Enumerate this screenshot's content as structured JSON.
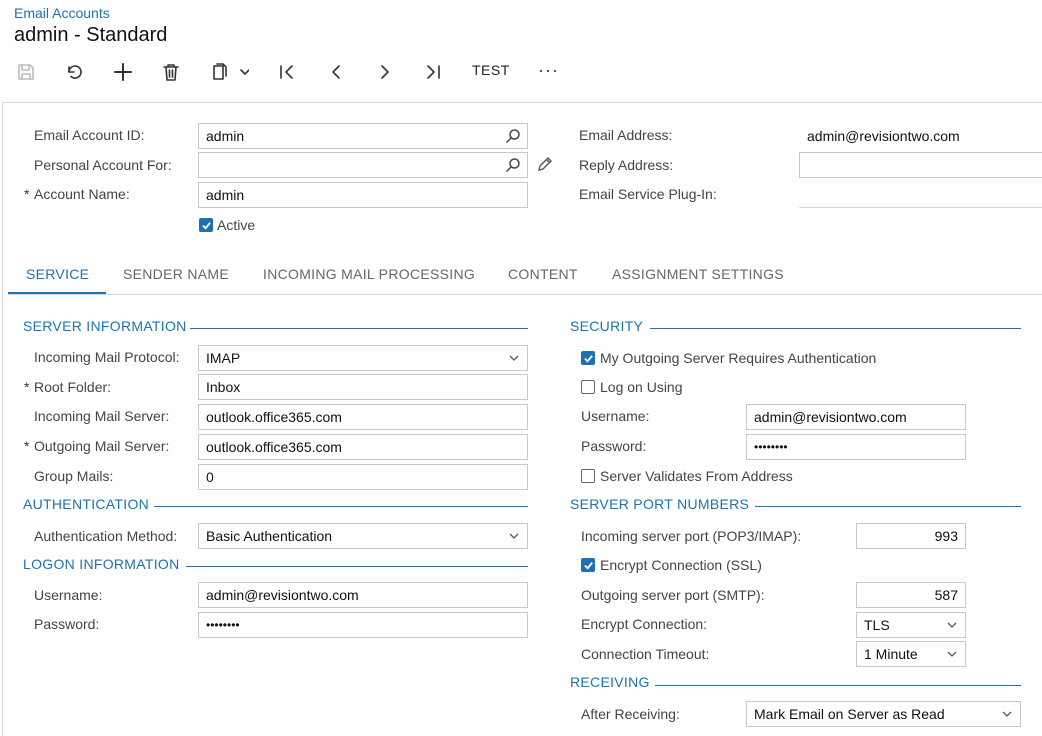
{
  "breadcrumb": "Email Accounts",
  "title": "admin - Standard",
  "toolbar": {
    "save_icon": "save-icon",
    "undo_icon": "undo-icon",
    "add_icon": "plus-icon",
    "delete_icon": "trash-icon",
    "copy_icon": "clipboard-icon",
    "first_icon": "first-record-icon",
    "prev_icon": "previous-icon",
    "next_icon": "next-icon",
    "last_icon": "last-record-icon",
    "test_label": "TEST",
    "more_label": "···"
  },
  "header": {
    "email_account_id_label": "Email Account ID:",
    "email_account_id_value": "admin",
    "personal_account_label": "Personal Account For:",
    "personal_account_value": "",
    "account_name_label": "Account Name:",
    "account_name_value": "admin",
    "active_label": "Active",
    "active_checked": true,
    "email_address_label": "Email Address:",
    "email_address_value": "admin@revisiontwo.com",
    "reply_address_label": "Reply Address:",
    "reply_address_value": "",
    "plugin_label": "Email Service Plug-In:"
  },
  "tabs": [
    "SERVICE",
    "SENDER NAME",
    "INCOMING MAIL PROCESSING",
    "CONTENT",
    "ASSIGNMENT SETTINGS"
  ],
  "active_tab": "SERVICE",
  "server_info": {
    "title": "SERVER INFORMATION",
    "protocol_label": "Incoming Mail Protocol:",
    "protocol_value": "IMAP",
    "root_folder_label": "Root Folder:",
    "root_folder_value": "Inbox",
    "incoming_server_label": "Incoming Mail Server:",
    "incoming_server_value": "outlook.office365.com",
    "outgoing_server_label": "Outgoing Mail Server:",
    "outgoing_server_value": "outlook.office365.com",
    "group_mails_label": "Group Mails:",
    "group_mails_value": "0"
  },
  "authentication": {
    "title": "AUTHENTICATION",
    "method_label": "Authentication Method:",
    "method_value": "Basic Authentication"
  },
  "logon": {
    "title": "LOGON INFORMATION",
    "username_label": "Username:",
    "username_value": "admin@revisiontwo.com",
    "password_label": "Password:",
    "password_value": "••••••••"
  },
  "security": {
    "title": "SECURITY",
    "requires_auth_label": "My Outgoing Server Requires Authentication",
    "requires_auth_checked": true,
    "log_on_using_label": "Log on Using",
    "log_on_using_checked": false,
    "username_label": "Username:",
    "username_value": "admin@revisiontwo.com",
    "password_label": "Password:",
    "password_value": "••••••••",
    "validates_from_label": "Server Validates From Address",
    "validates_from_checked": false
  },
  "ports": {
    "title": "SERVER PORT NUMBERS",
    "incoming_port_label": "Incoming server port (POP3/IMAP):",
    "incoming_port_value": "993",
    "encrypt_ssl_label": "Encrypt Connection (SSL)",
    "encrypt_ssl_checked": true,
    "outgoing_port_label": "Outgoing server port (SMTP):",
    "outgoing_port_value": "587",
    "encrypt_conn_label": "Encrypt Connection:",
    "encrypt_conn_value": "TLS",
    "timeout_label": "Connection Timeout:",
    "timeout_value": "1 Minute"
  },
  "receiving": {
    "title": "RECEIVING",
    "after_label": "After Receiving:",
    "after_value": "Mark Email on Server as Read"
  },
  "colors": {
    "accent": "#1a73b5",
    "checkbox": "#1f6fb5",
    "border": "#c9c9c9"
  }
}
